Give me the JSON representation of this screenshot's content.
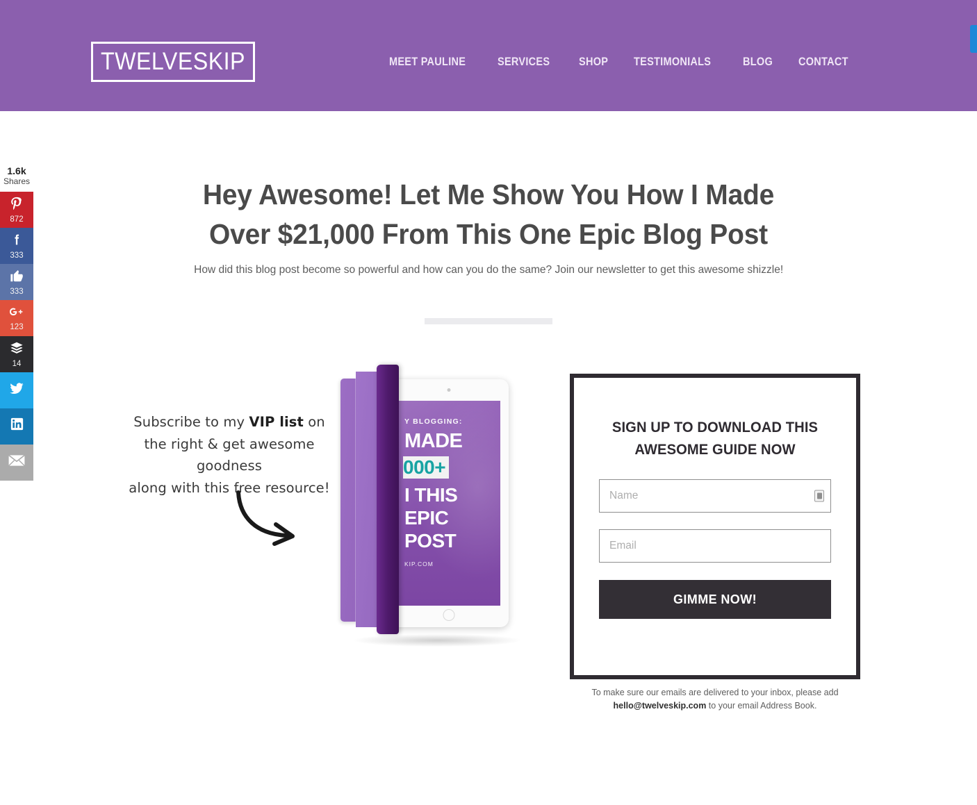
{
  "header": {
    "logo_text": "TWELVESKIP",
    "nav": [
      {
        "label": "MEET PAULINE"
      },
      {
        "label": "SERVICES"
      },
      {
        "label": "SHOP"
      },
      {
        "label": "TESTIMONIALS"
      },
      {
        "label": "BLOG"
      },
      {
        "label": "CONTACT"
      }
    ],
    "background_color": "#8b5fae"
  },
  "share_rail": {
    "total": "1.6k",
    "total_label": "Shares",
    "buttons": [
      {
        "network": "pinterest",
        "icon": "pinterest-icon",
        "glyph": "P",
        "count": "872",
        "color": "#c8232c"
      },
      {
        "network": "facebook",
        "icon": "facebook-icon",
        "glyph": "f",
        "count": "333",
        "color": "#3b5998"
      },
      {
        "network": "facebook-like",
        "icon": "thumbs-up-icon",
        "glyph": "👍",
        "count": "333",
        "color": "#5c74a8"
      },
      {
        "network": "google-plus",
        "icon": "google-plus-icon",
        "glyph": "G+",
        "count": "123",
        "color": "#e0513c"
      },
      {
        "network": "buffer",
        "icon": "buffer-icon",
        "glyph": "≣",
        "count": "14",
        "color": "#2b2b2e"
      },
      {
        "network": "twitter",
        "icon": "twitter-icon",
        "glyph": "🐦",
        "count": "",
        "color": "#20a7e8"
      },
      {
        "network": "linkedin",
        "icon": "linkedin-icon",
        "glyph": "in",
        "count": "",
        "color": "#1478b3"
      },
      {
        "network": "email",
        "icon": "envelope-icon",
        "glyph": "✉",
        "count": "",
        "color": "#ababab"
      }
    ]
  },
  "hero": {
    "title_line1": "Hey Awesome! Let Me Show You How I Made",
    "title_line2": "Over $21,000 From This One Epic Blog Post",
    "subtitle": "How did this blog post become so powerful and how can you do the same? Join our newsletter to get this awesome shizzle!"
  },
  "note": {
    "line1_pre": "Subscribe to my ",
    "line1_strong": "VIP list",
    "line1_post": " on",
    "line2": "the right & get awesome goodness",
    "line3": "along with this free resource!"
  },
  "tablet": {
    "kicker": "Y BLOGGING:",
    "made": "MADE",
    "amount": "000+",
    "line3": "I THIS",
    "line4": "EPIC",
    "line5": "POST",
    "site": "KIP.COM"
  },
  "signup": {
    "title_line1": "SIGN UP TO DOWNLOAD THIS",
    "title_line2": "AWESOME GUIDE NOW",
    "name_placeholder": "Name",
    "name_value": "",
    "email_placeholder": "Email",
    "email_value": "",
    "submit_label": "GIMME NOW!",
    "submit_color": "#332f35"
  },
  "form_note": {
    "part1": "To make sure our emails are delivered to your inbox, please add",
    "email": "hello@twelveskip.com",
    "part2": "to your email Address Book."
  }
}
